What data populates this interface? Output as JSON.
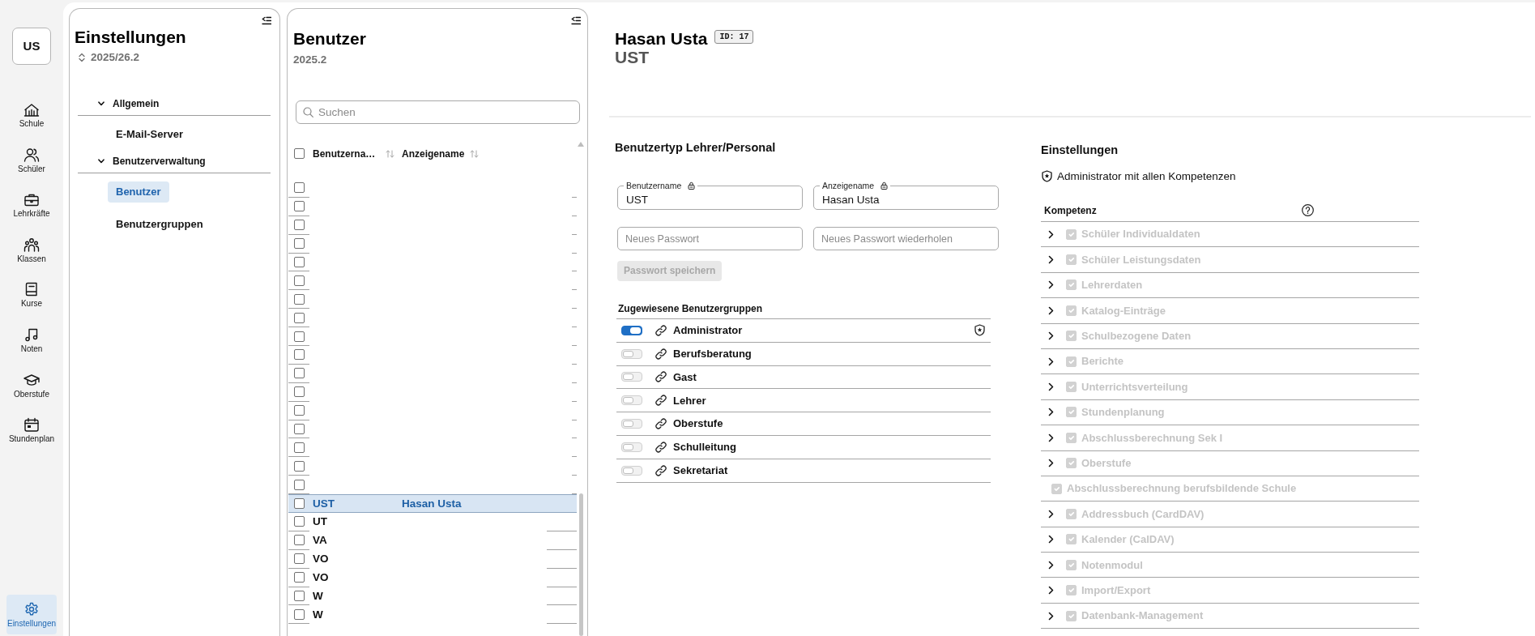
{
  "nav_rail": {
    "user_badge": "US",
    "items": [
      {
        "label": "Schule",
        "selected": false
      },
      {
        "label": "Schüler",
        "selected": false
      },
      {
        "label": "Lehrkräfte",
        "selected": false
      },
      {
        "label": "Klassen",
        "selected": false
      },
      {
        "label": "Kurse",
        "selected": false
      },
      {
        "label": "Noten",
        "selected": false
      },
      {
        "label": "Oberstufe",
        "selected": false
      },
      {
        "label": "Stundenplan",
        "selected": false
      }
    ],
    "bottom_items": [
      {
        "label": "Einstellungen",
        "selected": true
      }
    ]
  },
  "settings_panel": {
    "title": "Einstellungen",
    "subtitle": "2025/26.2",
    "tree": [
      {
        "label": "Allgemein",
        "expanded": true,
        "children": [
          {
            "label": "E-Mail-Server",
            "selected": false
          }
        ]
      },
      {
        "label": "Benutzerverwaltung",
        "expanded": true,
        "children": [
          {
            "label": "Benutzer",
            "selected": true
          },
          {
            "label": "Benutzergruppen",
            "selected": false
          }
        ]
      }
    ]
  },
  "users_panel": {
    "title": "Benutzer",
    "subtitle": "2025.2",
    "search": {
      "placeholder": "Suchen"
    },
    "table": {
      "all_checked": false,
      "columns": [
        "Benutzerna…",
        "Anzeigename"
      ],
      "rows": [
        {
          "checked": false,
          "selected": false
        },
        {
          "checked": false,
          "selected": false
        },
        {
          "checked": false,
          "selected": false
        },
        {
          "checked": false,
          "selected": false
        },
        {
          "checked": false,
          "selected": false
        },
        {
          "checked": false,
          "selected": false
        },
        {
          "checked": false,
          "selected": false
        },
        {
          "checked": false,
          "selected": false
        },
        {
          "checked": false,
          "selected": false
        },
        {
          "checked": false,
          "selected": false
        },
        {
          "checked": false,
          "selected": false
        },
        {
          "checked": false,
          "selected": false
        },
        {
          "checked": false,
          "selected": false
        },
        {
          "checked": false,
          "selected": false
        },
        {
          "checked": false,
          "selected": false
        },
        {
          "checked": false,
          "selected": false
        },
        {
          "checked": false,
          "selected": false
        },
        {
          "username": "UST",
          "display_name": "Hasan Usta",
          "checked": false,
          "selected": true
        },
        {
          "username": "UT",
          "checked": false,
          "selected": false
        },
        {
          "username": "VA",
          "checked": false,
          "selected": false
        },
        {
          "username": "VO",
          "checked": false,
          "selected": false
        },
        {
          "username": "VO",
          "checked": false,
          "selected": false
        },
        {
          "username": "W",
          "checked": false,
          "selected": false
        },
        {
          "username": "W",
          "checked": false,
          "selected": false
        }
      ]
    }
  },
  "user_detail": {
    "name": "Hasan Usta",
    "id_badge": "ID: 17",
    "code": "UST",
    "form": {
      "title": "Benutzertyp Lehrer/Personal",
      "fields": [
        {
          "kind": "labeled",
          "label": "Benutzername",
          "value": "UST",
          "locked": true
        },
        {
          "kind": "labeled",
          "label": "Anzeigename",
          "value": "Hasan Usta",
          "locked": true
        },
        {
          "kind": "password",
          "placeholder": "Neues Passwort"
        },
        {
          "kind": "password",
          "placeholder": "Neues Passwort wiederholen"
        }
      ],
      "save_button": {
        "label": "Passwort speichern",
        "disabled": true
      }
    },
    "groups": {
      "title": "Zugewiesene Benutzergruppen",
      "items": [
        {
          "label": "Administrator",
          "on": true,
          "admin": true
        },
        {
          "label": "Berufsberatung",
          "on": false,
          "admin": false
        },
        {
          "label": "Gast",
          "on": false,
          "admin": false
        },
        {
          "label": "Lehrer",
          "on": false,
          "admin": false
        },
        {
          "label": "Oberstufe",
          "on": false,
          "admin": false
        },
        {
          "label": "Schulleitung",
          "on": false,
          "admin": false
        },
        {
          "label": "Sekretariat",
          "on": false,
          "admin": false
        }
      ]
    },
    "competences": {
      "title": "Einstellungen",
      "admin_note": "Administrator mit allen Kompetenzen",
      "column": "Kompetenz",
      "items": [
        {
          "label": "Schüler Individualdaten",
          "expandable": true,
          "checked": true,
          "disabled": true
        },
        {
          "label": "Schüler Leistungsdaten",
          "expandable": true,
          "checked": true,
          "disabled": true
        },
        {
          "label": "Lehrerdaten",
          "expandable": true,
          "checked": true,
          "disabled": true
        },
        {
          "label": "Katalog-Einträge",
          "expandable": true,
          "checked": true,
          "disabled": true
        },
        {
          "label": "Schulbezogene Daten",
          "expandable": true,
          "checked": true,
          "disabled": true
        },
        {
          "label": "Berichte",
          "expandable": true,
          "checked": true,
          "disabled": true
        },
        {
          "label": "Unterrichtsverteilung",
          "expandable": true,
          "checked": true,
          "disabled": true
        },
        {
          "label": "Stundenplanung",
          "expandable": true,
          "checked": true,
          "disabled": true
        },
        {
          "label": "Abschlussberechnung Sek I",
          "expandable": true,
          "checked": true,
          "disabled": true
        },
        {
          "label": "Oberstufe",
          "expandable": true,
          "checked": true,
          "disabled": true
        },
        {
          "label": "Abschlussberechnung berufsbildende Schule",
          "expandable": false,
          "checked": true,
          "disabled": true
        },
        {
          "label": "Addressbuch (CardDAV)",
          "expandable": true,
          "checked": true,
          "disabled": true
        },
        {
          "label": "Kalender (CalDAV)",
          "expandable": true,
          "checked": true,
          "disabled": true
        },
        {
          "label": "Notenmodul",
          "expandable": true,
          "checked": true,
          "disabled": true
        },
        {
          "label": "Import/Export",
          "expandable": true,
          "checked": true,
          "disabled": true
        },
        {
          "label": "Datenbank-Management",
          "expandable": true,
          "checked": true,
          "disabled": true
        }
      ]
    }
  }
}
